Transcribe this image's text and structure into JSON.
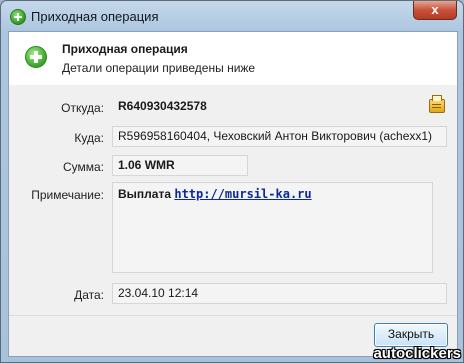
{
  "window": {
    "title": "Приходная операция",
    "close_label": "x"
  },
  "header": {
    "title": "Приходная операция",
    "subtitle": "Детали операции приведены ниже"
  },
  "fields": {
    "from_label": "Откуда:",
    "from_value": "R640930432578",
    "to_label": "Куда:",
    "to_value": "R596958160404, Чеховский Антон Викторович (achexx1)",
    "amount_label": "Сумма:",
    "amount_value": "1.06 WMR",
    "note_label": "Примечание:",
    "note_text": "Выплата",
    "note_link": "http://mursil-ka.ru",
    "date_label": "Дата:",
    "date_value": "23.04.10 12:14"
  },
  "buttons": {
    "close_label": "Закрыть"
  },
  "watermark": "autoclickers",
  "icons": {
    "title": "add-circle-icon",
    "header": "add-circle-icon",
    "copy": "clipboard-copy-icon"
  },
  "colors": {
    "accent_green": "#36a424",
    "link": "#0a2a9a",
    "button_border": "#3c7fb1"
  }
}
